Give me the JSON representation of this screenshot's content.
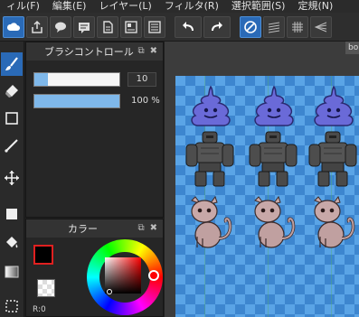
{
  "menu": [
    {
      "label": "ィル(F)"
    },
    {
      "label": "編集(E)"
    },
    {
      "label": "レイヤー(L)"
    },
    {
      "label": "フィルタ(R)"
    },
    {
      "label": "選択範囲(S)"
    },
    {
      "label": "定規(N)"
    }
  ],
  "brush_panel": {
    "title": "ブラシコントロール",
    "size_value": "10",
    "size_fraction": 0.16,
    "opacity_value": "100 %",
    "opacity_fraction": 1.0
  },
  "color_panel": {
    "title": "カラー",
    "rgb_label": "R:0",
    "fg_color": "#000000",
    "hue_color": "#ff0000"
  },
  "document": {
    "tab_label": "bo"
  },
  "colors": {
    "accent": "#2a6ab7",
    "canvas_dark": "#3d86cf",
    "canvas_light": "#5aa4e6"
  },
  "sprites": {
    "row1": "slime-sprite",
    "row2": "golem-sprite",
    "row3": "cat-sprite"
  }
}
